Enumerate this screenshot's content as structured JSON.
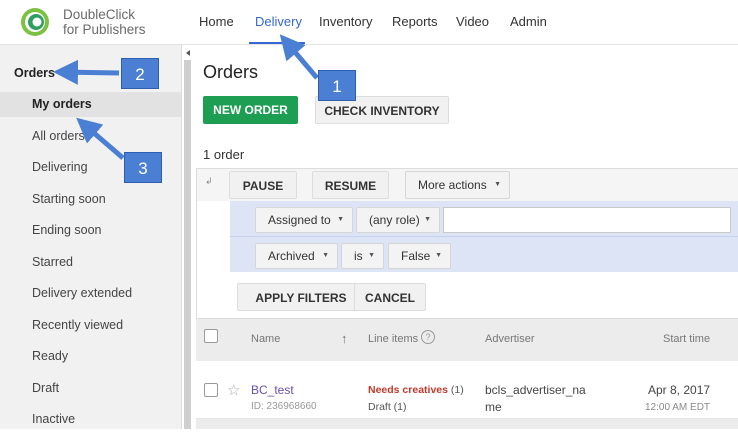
{
  "brand": {
    "line1": "DoubleClick",
    "line2": "for Publishers"
  },
  "nav": [
    "Home",
    "Delivery",
    "Inventory",
    "Reports",
    "Video",
    "Admin"
  ],
  "sidebar": {
    "title": "Orders",
    "items": [
      "My orders",
      "All orders",
      "Delivering",
      "Starting soon",
      "Ending soon",
      "Starred",
      "Delivery extended",
      "Recently viewed",
      "Ready",
      "Draft",
      "Inactive"
    ]
  },
  "main": {
    "title": "Orders",
    "new_order": "NEW ORDER",
    "check_inventory": "CHECK INVENTORY",
    "count": "1 order"
  },
  "toolbar": {
    "pause": "PAUSE",
    "resume": "RESUME",
    "more_actions": "More actions"
  },
  "filters": {
    "row1": {
      "field": "Assigned to",
      "role": "(any role)",
      "value": ""
    },
    "row2": {
      "field": "Archived",
      "op": "is",
      "value": "False"
    },
    "apply": "APPLY FILTERS",
    "cancel": "CANCEL"
  },
  "table": {
    "headers": {
      "name": "Name",
      "line_items": "Line items",
      "advertiser": "Advertiser",
      "start_time": "Start time"
    },
    "rows": [
      {
        "name": "BC_test",
        "id": "ID: 236968660",
        "status": "Needs creatives",
        "status_count": "(1)",
        "draft": "Draft (1)",
        "advertiser_l1": "bcls_advertiser_na",
        "advertiser_l2": "me",
        "start_date": "Apr 8, 2017",
        "start_time": "12:00 AM EDT"
      }
    ]
  },
  "annotations": [
    "1",
    "2",
    "3"
  ],
  "colors": {
    "accent": "#3367d6",
    "primary_button": "#1e9e52",
    "callout": "#4a7fd3",
    "status_red": "#c0392b",
    "link": "#6b4fa8"
  }
}
